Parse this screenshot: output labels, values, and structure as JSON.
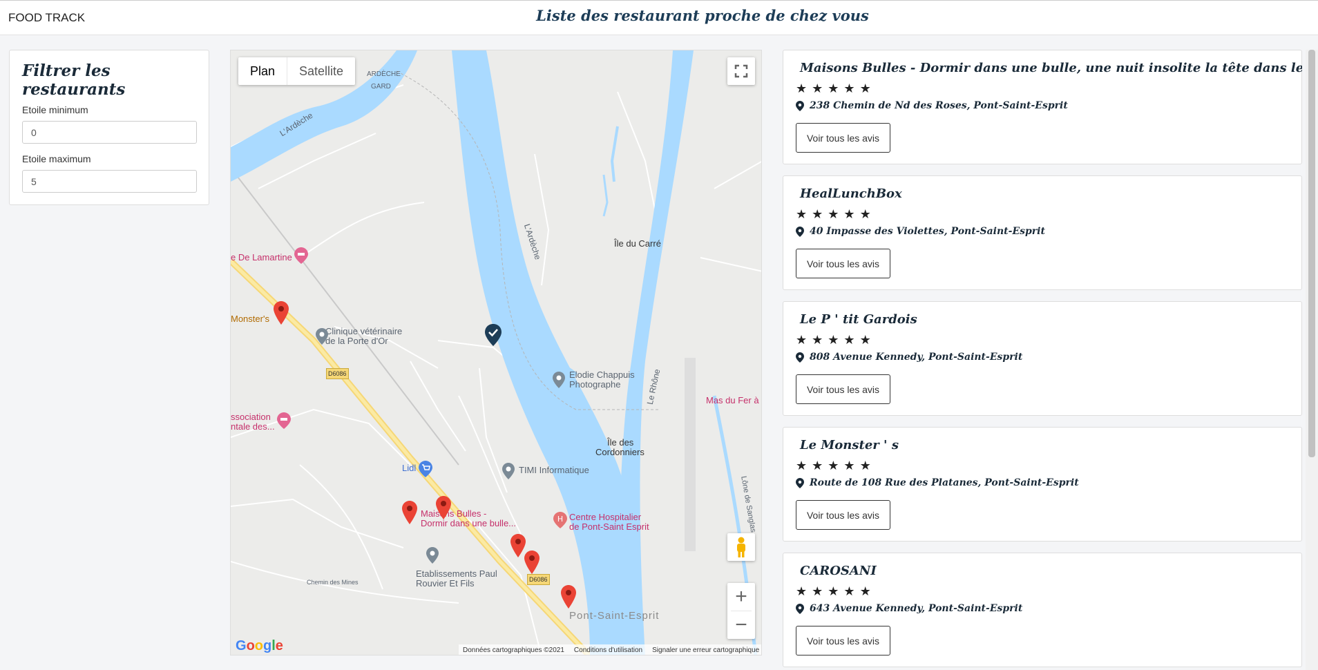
{
  "header": {
    "brand": "FOOD TRACK",
    "title": "Liste des restaurant proche de chez vous"
  },
  "filter": {
    "title": "Filtrer les restaurants",
    "min_label": "Etoile minimum",
    "min_value": "0",
    "max_label": "Etoile maximum",
    "max_value": "5"
  },
  "map": {
    "map_type_plan": "Plan",
    "map_type_satellite": "Satellite",
    "labels": {
      "ardeche_gard_1": "ARDÈCHE",
      "ardeche_gard_2": "GARD",
      "lardeche_river": "L'Ardèche",
      "lardeche_river_2": "L'Ardèche",
      "ile_du_carre": "Île du Carré",
      "de_lamartine": "e De Lamartine",
      "monsters": "Monster's",
      "clinique_1": "Clinique vétérinaire",
      "clinique_2": "de la Porte d'Or",
      "d6086": "D6086",
      "elodie_1": "Elodie Chappuis",
      "elodie_2": "Photographe",
      "le_rhone": "Le Rhône",
      "mas_du_fer": "Mas du Fer à",
      "association_1": "ssociation",
      "association_2": "ntale des...",
      "ile_cordonniers_1": "Île des",
      "ile_cordonniers_2": "Cordonniers",
      "lidl": "Lidl",
      "timi": "TIMI Informatique",
      "maisons_1": "Maisons Bulles -",
      "maisons_2": "Dormir dans une bulle...",
      "centre_1": "Centre Hospitalier",
      "centre_2": "de Pont-Saint Esprit",
      "etab_1": "Etablissements Paul",
      "etab_2": "Rouvier Et Fils",
      "d6086_b": "D6086",
      "pont_saint_esprit": "Pont-Saint-Esprit",
      "lone_de_sanglas": "Lône de Sanglas",
      "chemin_des_mines": "Chemin des Mines"
    },
    "footer": {
      "data": "Données cartographiques ©2021",
      "terms": "Conditions d'utilisation",
      "report": "Signaler une erreur cartographique"
    },
    "google": "Google"
  },
  "restaurants": [
    {
      "name": "Maisons Bulles - Dormir dans une bulle, une nuit insolite la tête dans les étoiles",
      "rating": 5,
      "address": "238 Chemin de Nd des Roses, Pont-Saint-Esprit",
      "button": "Voir tous les avis"
    },
    {
      "name": "HealLunchBox",
      "rating": 5,
      "address": "40 Impasse des Violettes, Pont-Saint-Esprit",
      "button": "Voir tous les avis"
    },
    {
      "name": "Le P ' tit Gardois",
      "rating": 5,
      "address": "808 Avenue Kennedy, Pont-Saint-Esprit",
      "button": "Voir tous les avis"
    },
    {
      "name": "Le Monster ' s",
      "rating": 5,
      "address": "Route de 108 Rue des Platanes, Pont-Saint-Esprit",
      "button": "Voir tous les avis"
    },
    {
      "name": "CAROSANI",
      "rating": 5,
      "address": "643 Avenue Kennedy, Pont-Saint-Esprit",
      "button": "Voir tous les avis"
    }
  ],
  "colors": {
    "accent": "#1d3d57",
    "river": "#aadaff",
    "pin": "#e53935",
    "poi": "#c52f6a"
  }
}
